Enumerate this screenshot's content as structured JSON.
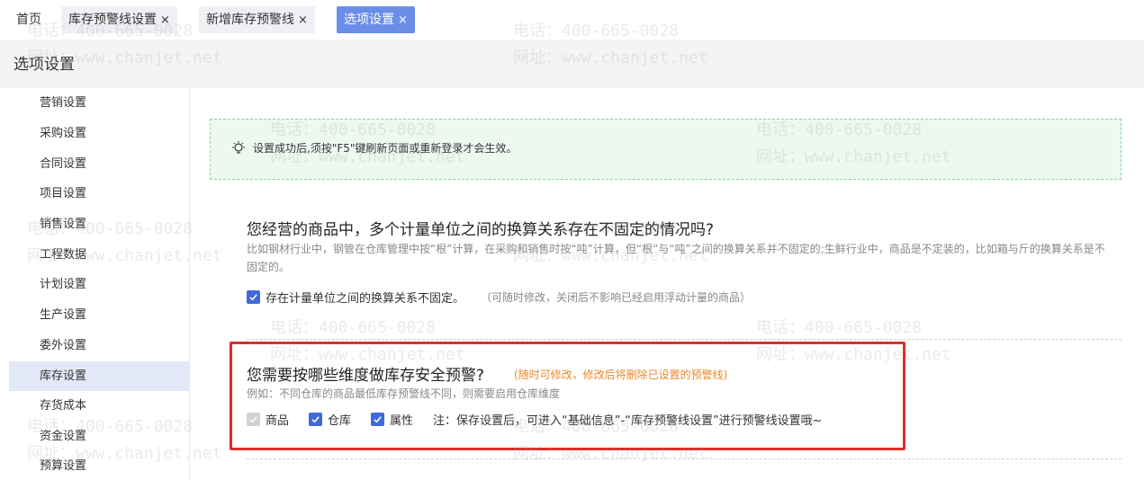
{
  "tabs": [
    {
      "label": "首页",
      "closable": false,
      "active": false
    },
    {
      "label": "库存预警线设置",
      "closable": true,
      "active": false
    },
    {
      "label": "新增库存预警线",
      "closable": true,
      "active": false
    },
    {
      "label": "选项设置",
      "closable": true,
      "active": true
    }
  ],
  "close_glyph": "×",
  "page_title": "选项设置",
  "sidebar": {
    "items": [
      {
        "label": "营销设置"
      },
      {
        "label": "采购设置"
      },
      {
        "label": "合同设置"
      },
      {
        "label": "项目设置"
      },
      {
        "label": "销售设置"
      },
      {
        "label": "工程数据"
      },
      {
        "label": "计划设置"
      },
      {
        "label": "生产设置"
      },
      {
        "label": "委外设置"
      },
      {
        "label": "库存设置",
        "active": true
      },
      {
        "label": "存货成本"
      },
      {
        "label": "资金设置"
      },
      {
        "label": "预算设置"
      }
    ]
  },
  "notice": {
    "text": "设置成功后,须按\"F5\"键刷新页面或重新登录才会生效。",
    "icon": "lightbulb-icon"
  },
  "section1": {
    "title": "您经营的商品中，多个计量单位之间的换算关系存在不固定的情况吗?",
    "desc": "比如钢材行业中，钢管在仓库管理中按“根”计算，在采购和销售时按“吨”计算，但“根”与“吨”之间的换算关系并不固定的;生鲜行业中，商品是不定装的，比如箱与斤的换算关系是不固定的。",
    "checkbox_label": "存在计量单位之间的换算关系不固定。",
    "checkbox_checked": true,
    "hint": "（可随时修改，关闭后不影响已经启用浮动计量的商品）"
  },
  "section2": {
    "title": "您需要按哪些维度做库存安全预警?",
    "warning": "(随时可修改，修改后将删除已设置的预警线)",
    "desc": "例如：不同仓库的商品最低库存预警线不同，则需要启用仓库维度",
    "options": [
      {
        "label": "商品",
        "checked": true,
        "disabled": true
      },
      {
        "label": "仓库",
        "checked": true,
        "disabled": false
      },
      {
        "label": "属性",
        "checked": true,
        "disabled": false
      }
    ],
    "note": "注：保存设置后，可进入“基础信息”-“库存预警线设置”进行预警线设置哦~"
  },
  "watermark": {
    "phone": "电话：400-665-0028",
    "site": "网址：www.chanjet.net"
  },
  "colors": {
    "accent": "#3f6ad8",
    "active_tab": "#6a8ee8",
    "warning": "#e8892b",
    "highlight_box": "#d9302a",
    "notice_bg": "#edf8f1"
  }
}
